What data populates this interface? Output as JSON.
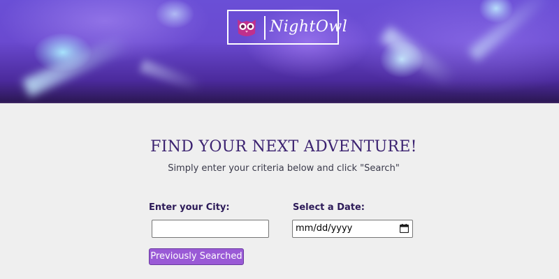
{
  "brand": {
    "name": "NightOwl",
    "logo_icon": "owl-icon"
  },
  "hero": {
    "background": "purple concert light backdrop"
  },
  "main": {
    "headline": "FIND YOUR NEXT ADVENTURE!",
    "subtitle": "Simply enter your criteria below and click \"Search\"",
    "city": {
      "label": "Enter your City:",
      "value": "",
      "placeholder": ""
    },
    "date": {
      "label": "Select a Date:",
      "value": "mm/dd/yyyy",
      "icon": "calendar-icon"
    },
    "previous_button_label": "Previously Searched"
  },
  "colors": {
    "accent": "#9a5ad6",
    "heading": "#3b2270",
    "background": "#efefef"
  }
}
